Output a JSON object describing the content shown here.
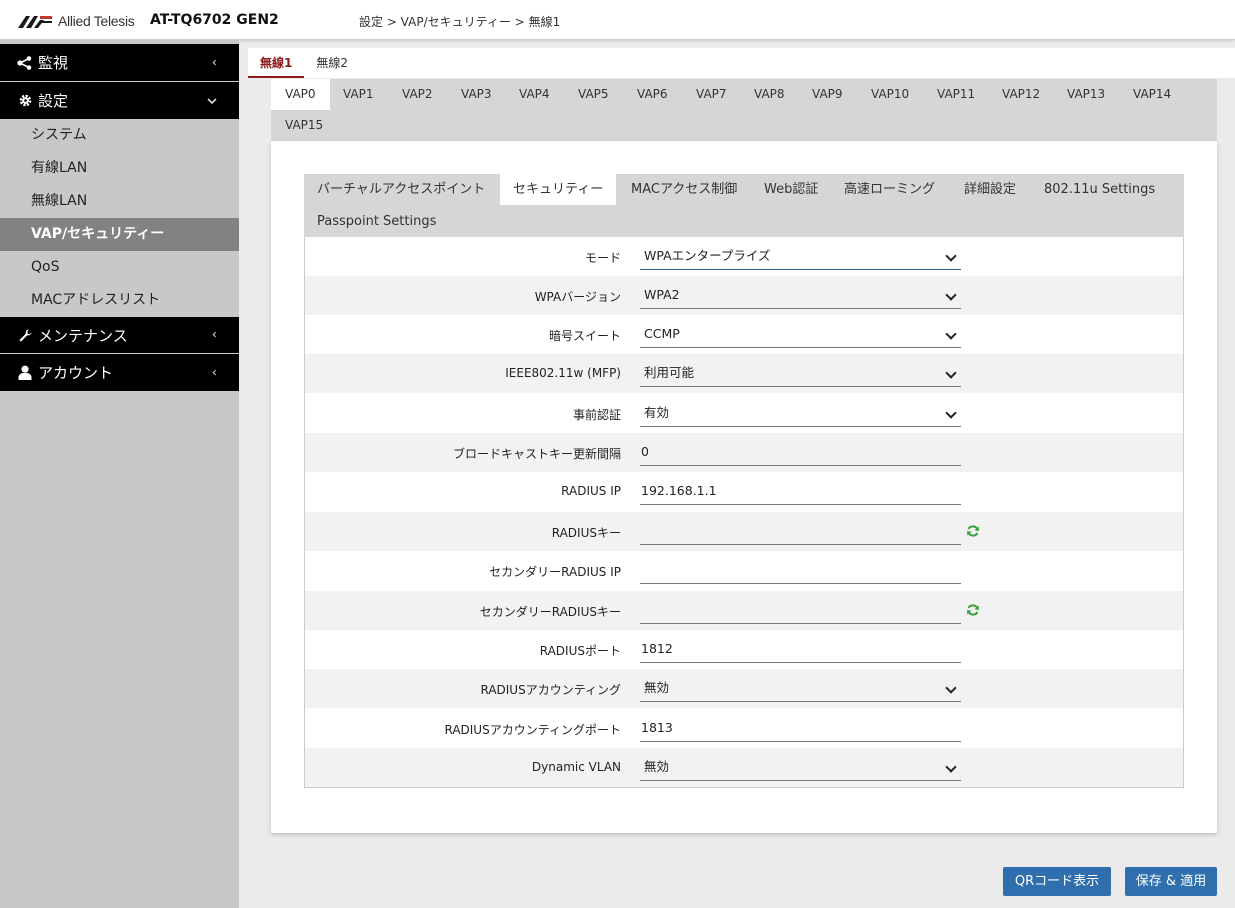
{
  "header": {
    "brand": "Allied Telesis",
    "model": "AT-TQ6702 GEN2",
    "breadcrumb": "設定 > VAP/セキュリティー > 無線1"
  },
  "sidebar": {
    "sections": [
      {
        "label": "監視",
        "icon": "share-icon",
        "chevron": "‹"
      },
      {
        "label": "設定",
        "icon": "gear-icon",
        "chevron": "⌄"
      },
      {
        "label": "メンテナンス",
        "icon": "wrench-icon",
        "chevron": "‹"
      },
      {
        "label": "アカウント",
        "icon": "user-icon",
        "chevron": "‹"
      }
    ],
    "items": [
      {
        "label": "システム"
      },
      {
        "label": "有線LAN"
      },
      {
        "label": "無線LAN"
      },
      {
        "label": "VAP/セキュリティー"
      },
      {
        "label": "QoS"
      },
      {
        "label": "MACアドレスリスト"
      }
    ]
  },
  "radio_tabs": [
    "無線1",
    "無線2"
  ],
  "vap_tabs": [
    "VAP0",
    "VAP1",
    "VAP2",
    "VAP3",
    "VAP4",
    "VAP5",
    "VAP6",
    "VAP7",
    "VAP8",
    "VAP9",
    "VAP10",
    "VAP11",
    "VAP12",
    "VAP13",
    "VAP14",
    "VAP15"
  ],
  "sec_tabs": [
    "バーチャルアクセスポイント",
    "セキュリティー",
    "MACアクセス制御",
    "Web認証",
    "高速ローミング",
    "詳細設定",
    "802.11u Settings",
    "Passpoint Settings"
  ],
  "form": [
    {
      "label": "モード",
      "value": "WPAエンタープライズ"
    },
    {
      "label": "WPAバージョン",
      "value": "WPA2"
    },
    {
      "label": "暗号スイート",
      "value": "CCMP"
    },
    {
      "label": "IEEE802.11w (MFP)",
      "value": "利用可能"
    },
    {
      "label": "事前認証",
      "value": "有効"
    },
    {
      "label": "ブロードキャストキー更新間隔",
      "value": "0"
    },
    {
      "label": "RADIUS IP",
      "value": "192.168.1.1"
    },
    {
      "label": "RADIUSキー",
      "value": ""
    },
    {
      "label": "セカンダリーRADIUS IP",
      "value": ""
    },
    {
      "label": "セカンダリーRADIUSキー",
      "value": ""
    },
    {
      "label": "RADIUSポート",
      "value": "1812"
    },
    {
      "label": "RADIUSアカウンティング",
      "value": "無効"
    },
    {
      "label": "RADIUSアカウンティングポート",
      "value": "1813"
    },
    {
      "label": "Dynamic VLAN",
      "value": "無効"
    }
  ],
  "buttons": {
    "qr": "QRコード表示",
    "save": "保存 & 適用"
  },
  "colors": {
    "accent": "#8b1a1a",
    "button": "#2f6fad",
    "refresh_icon": "#3aa03a"
  }
}
